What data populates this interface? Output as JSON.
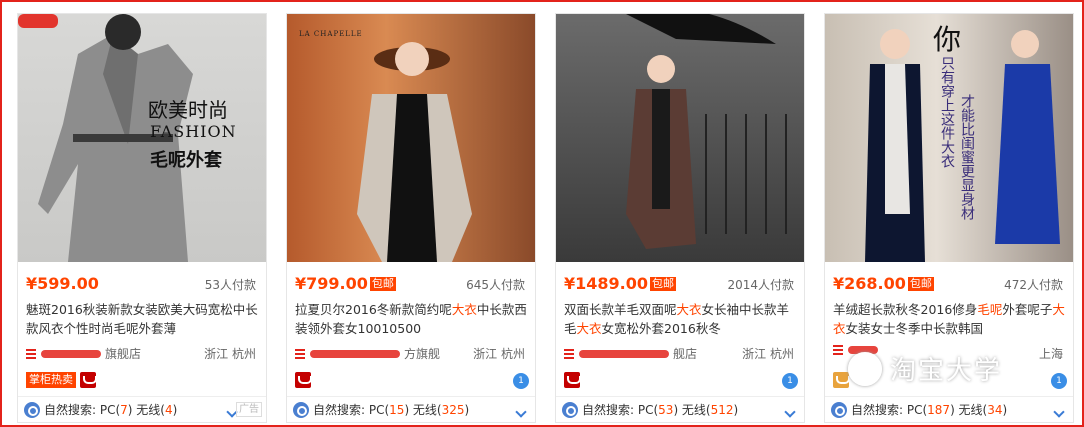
{
  "items": [
    {
      "price": "¥599.00",
      "baoyou": "",
      "paid": "53人付款",
      "title_a": "魅斑2016秋装新款女装欧美大码宽松中长款风衣个性时尚毛呢外套薄",
      "title_hl": "",
      "title_b": "",
      "shop": "旗舰店",
      "location": "浙江 杭州",
      "badge": "掌柜热卖",
      "search_label": "自然搜索: PC(",
      "pc": "7",
      "wx_label": ") 无线(",
      "wx": "4",
      "end": ")",
      "ad": "广告",
      "img_text": [
        "欧美时尚",
        "FASHION",
        "毛呢外套"
      ]
    },
    {
      "price": "¥799.00",
      "baoyou": "包邮",
      "paid": "645人付款",
      "title_a": "拉夏贝尔2016冬新款简约呢",
      "title_hl": "大衣",
      "title_b": "中长款西装领外套女10010500",
      "shop": "方旗舰",
      "location": "浙江 杭州",
      "badge": "",
      "search_label": "自然搜索: PC(",
      "pc": "15",
      "wx_label": ") 无线(",
      "wx": "325",
      "end": ")",
      "ad": "",
      "img_text": [
        "LA CHAPELLE"
      ]
    },
    {
      "price": "¥1489.00",
      "baoyou": "包邮",
      "paid": "2014人付款",
      "title_a": "双面长款羊毛双面呢",
      "title_hl": "大衣",
      "title_b": "女长袖中长款羊毛",
      "title_hl2": "大衣",
      "title_c": "女宽松外套2016秋冬",
      "shop": "舰店",
      "location": "浙江 杭州",
      "badge": "",
      "search_label": "自然搜索: PC(",
      "pc": "53",
      "wx_label": ") 无线(",
      "wx": "512",
      "end": ")",
      "ad": "",
      "img_text": []
    },
    {
      "price": "¥268.00",
      "baoyou": "包邮",
      "paid": "472人付款",
      "title_a": "羊绒超长款秋冬2016修身",
      "title_hl": "毛呢",
      "title_b": "外套呢子",
      "title_hl2": "大衣",
      "title_c": "女装女士冬季中长款韩国",
      "shop": "",
      "location": "上海",
      "badge": "",
      "search_label": "自然搜索: PC(",
      "pc": "187",
      "wx_label": ") 无线(",
      "wx": "34",
      "end": ")",
      "ad": "",
      "img_text": [
        "你",
        "只有穿上这件大衣",
        "才能比闺蜜更显身材"
      ]
    }
  ],
  "watermark": "淘宝大学",
  "colors": {
    "accent": "#ff4400",
    "frame": "#e3231b",
    "link": "#3a7bd5"
  }
}
